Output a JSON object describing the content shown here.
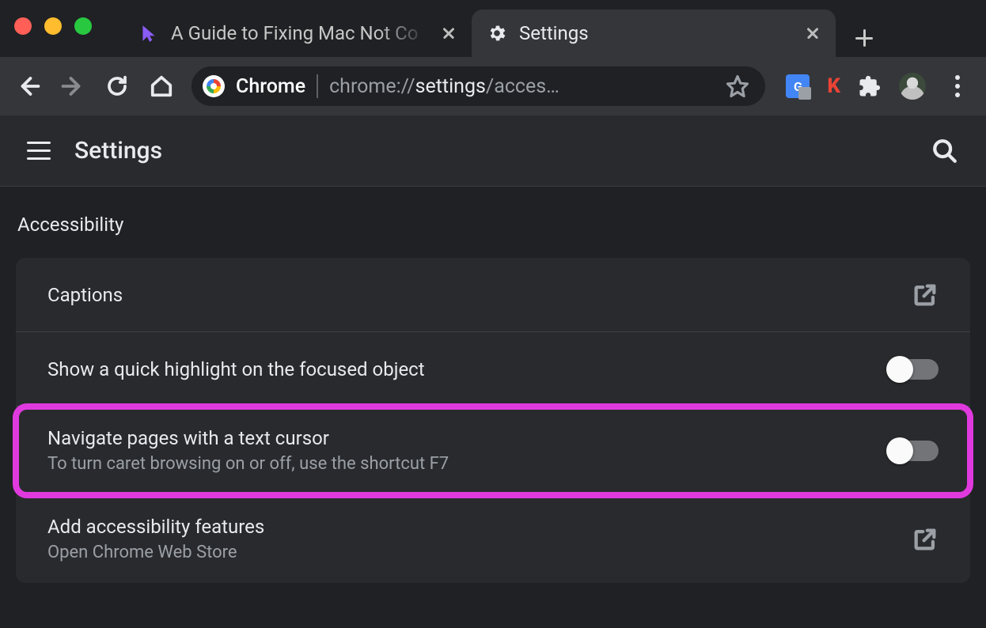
{
  "window": {
    "tabs": [
      {
        "title": "A Guide to Fixing Mac Not Co",
        "active": false,
        "favicon": "cursor-icon"
      },
      {
        "title": "Settings",
        "active": true,
        "favicon": "gear-icon"
      }
    ]
  },
  "toolbar": {
    "chip_label": "Chrome",
    "url_prefix": "chrome://",
    "url_bold": "settings",
    "url_suffix": "/acces…",
    "extensions": {
      "translate": "G",
      "k": "K"
    }
  },
  "header": {
    "title": "Settings"
  },
  "section": {
    "title": "Accessibility",
    "rows": [
      {
        "primary": "Captions",
        "action": "open"
      },
      {
        "primary": "Show a quick highlight on the focused object",
        "action": "toggle",
        "on": false
      },
      {
        "primary": "Navigate pages with a text cursor",
        "secondary": "To turn caret browsing on or off, use the shortcut F7",
        "action": "toggle",
        "on": false,
        "highlight": true
      },
      {
        "primary": "Add accessibility features",
        "secondary": "Open Chrome Web Store",
        "action": "open"
      }
    ]
  }
}
